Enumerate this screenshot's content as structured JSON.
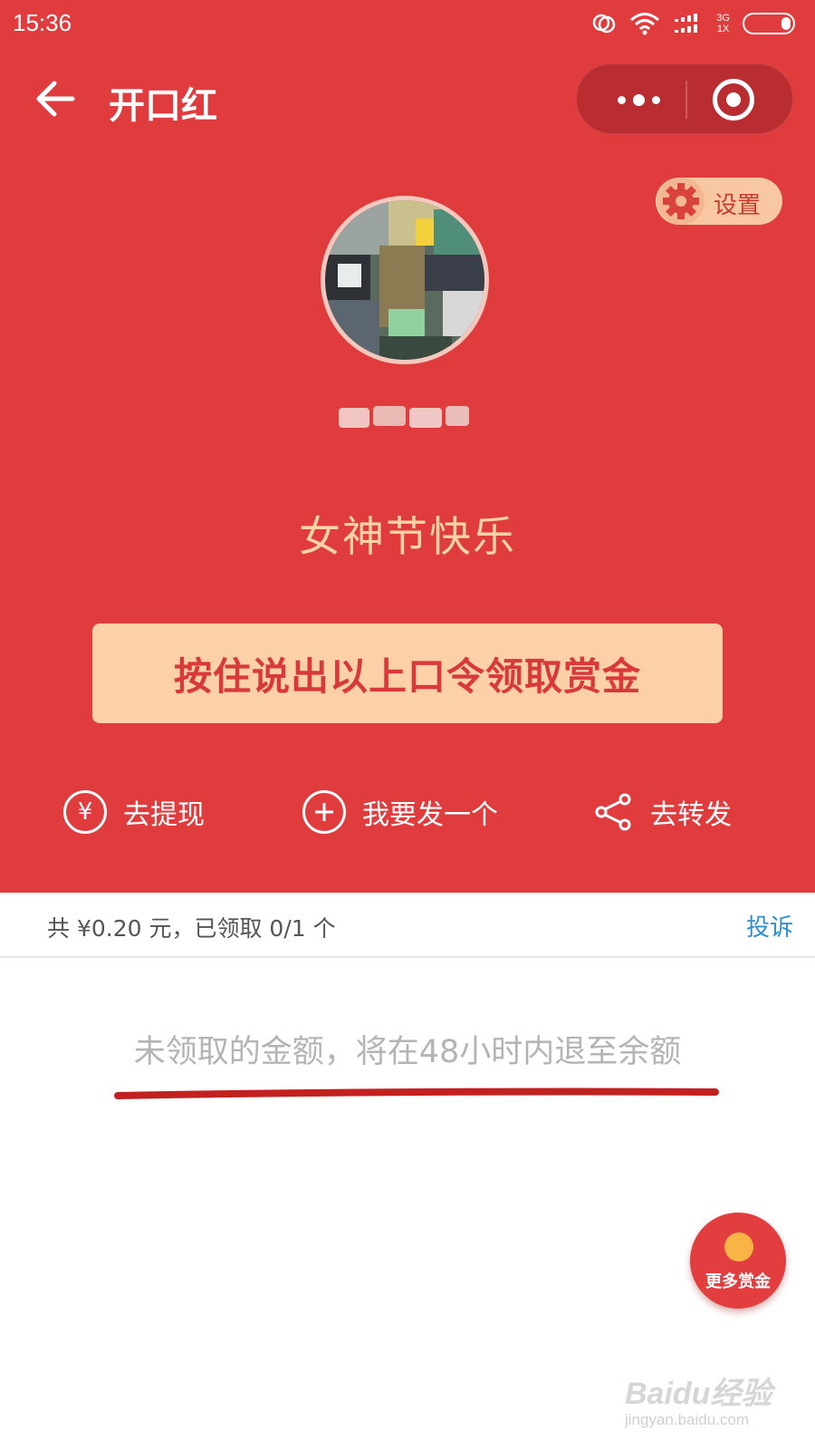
{
  "status_bar": {
    "time": "15:36",
    "network_top": "3G",
    "network_bottom": "1X"
  },
  "nav": {
    "title": "开口红"
  },
  "settings": {
    "label": "设置"
  },
  "greeting": "女神节快乐",
  "voice_button": {
    "label": "按住说出以上口令领取赏金"
  },
  "actions": [
    {
      "label": "去提现",
      "icon": "yen-icon"
    },
    {
      "label": "我要发一个",
      "icon": "plus-circle-icon"
    },
    {
      "label": "去转发",
      "icon": "share-icon"
    }
  ],
  "info": {
    "summary": "共 ¥0.20 元，已领取 0/1 个",
    "complaint": "投诉"
  },
  "refund_note": "未领取的金额，将在48小时内退至余额",
  "fab": {
    "label": "更多赏金"
  },
  "watermark": {
    "logo": "Baidu经验",
    "url": "jingyan.baidu.com"
  },
  "colors": {
    "header_red": "#e03c3e",
    "button_peach": "#fdd1a8",
    "link_blue": "#2a8fd4"
  }
}
